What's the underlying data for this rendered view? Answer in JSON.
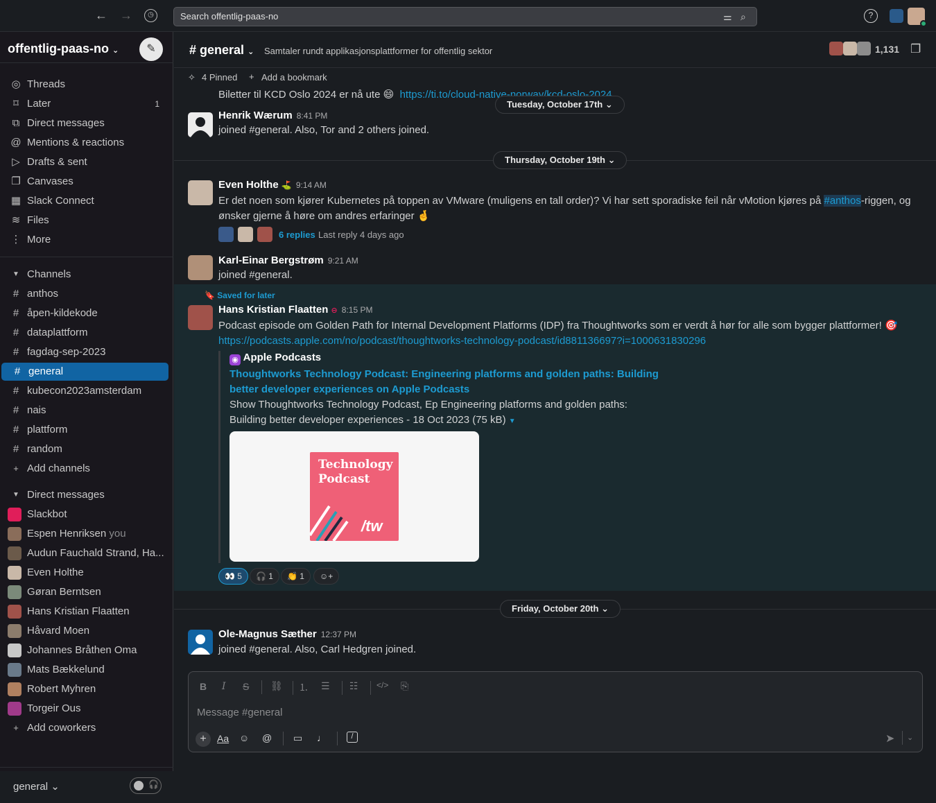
{
  "topbar": {
    "search_placeholder": "Search offentlig-paas-no",
    "help": "?"
  },
  "sidebar": {
    "workspace": "offentlig-paas-no",
    "nav": [
      {
        "label": "Threads",
        "icon": "threads-icon",
        "glyph": "◎",
        "count": ""
      },
      {
        "label": "Later",
        "icon": "bookmark-icon",
        "glyph": "⌑",
        "count": "1"
      },
      {
        "label": "Direct messages",
        "icon": "dm-icon",
        "glyph": "⧉",
        "count": ""
      },
      {
        "label": "Mentions & reactions",
        "icon": "at-icon",
        "glyph": "@",
        "count": ""
      },
      {
        "label": "Drafts & sent",
        "icon": "send-icon",
        "glyph": "▷",
        "count": ""
      },
      {
        "label": "Canvases",
        "icon": "canvas-icon",
        "glyph": "❐",
        "count": ""
      },
      {
        "label": "Slack Connect",
        "icon": "building-icon",
        "glyph": "▦",
        "count": ""
      },
      {
        "label": "Files",
        "icon": "files-icon",
        "glyph": "≋",
        "count": ""
      },
      {
        "label": "More",
        "icon": "more-icon",
        "glyph": "⋮",
        "count": ""
      }
    ],
    "channels_header": "Channels",
    "channels": [
      "anthos",
      "åpen-kildekode",
      "dataplattform",
      "fagdag-sep-2023",
      "general",
      "kubecon2023amsterdam",
      "nais",
      "plattform",
      "random"
    ],
    "add_channels": "Add channels",
    "dm_header": "Direct messages",
    "dms": [
      {
        "name": "Slackbot",
        "extra": "",
        "color": "#e01e5a"
      },
      {
        "name": "Espen Henriksen",
        "extra": "you",
        "color": "#8a6d5a"
      },
      {
        "name": "Audun Fauchald Strand, Ha...",
        "extra": "",
        "color": "#6b5a4a"
      },
      {
        "name": "Even Holthe",
        "extra": "",
        "color": "#c9b8a8"
      },
      {
        "name": "Gøran Berntsen",
        "extra": "",
        "color": "#7b8a7a"
      },
      {
        "name": "Hans Kristian Flaatten",
        "extra": "",
        "color": "#a0524a"
      },
      {
        "name": "Håvard Moen",
        "extra": "",
        "color": "#8c7c6c"
      },
      {
        "name": "Johannes Bråthen Oma",
        "extra": "",
        "color": "#c8c8c8"
      },
      {
        "name": "Mats Bækkelund",
        "extra": "",
        "color": "#6a7a8a"
      },
      {
        "name": "Robert Myhren",
        "extra": "",
        "color": "#b08060"
      },
      {
        "name": "Torgeir Ous",
        "extra": "",
        "color": "#a03a8a"
      }
    ],
    "add_coworkers": "Add coworkers",
    "footer_label": "general"
  },
  "channel": {
    "name": "# general",
    "topic": "Samtaler rundt applikasjonsplattformer for offentlig sektor",
    "member_count": "1,131",
    "pinned": "4 Pinned",
    "add_bookmark": "Add a bookmark"
  },
  "messages": {
    "prev_text": "Biletter til KCD Oslo 2024 er nå ute 😄",
    "prev_link": "https://ti.to/cloud-native-norway/kcd-oslo-2024",
    "date1": "Tuesday, October 17th",
    "m1": {
      "author": "Henrik Wærum",
      "time": "8:41 PM",
      "text": "joined #general. Also, Tor and 2 others joined."
    },
    "date2": "Thursday, October 19th",
    "m2": {
      "author": "Even Holthe",
      "time": "9:14 AM",
      "text_a": "Er det noen som kjører Kubernetes på toppen av VMware (muligens en tall order)? Vi har sett sporadiske feil når vMotion kjøres på ",
      "mention": "#anthos",
      "text_b": "-riggen, og",
      "text_c": "ønsker gjerne å høre om andres erfaringer 🤞",
      "replies": "6 replies",
      "last_reply": "Last reply 4 days ago"
    },
    "m3": {
      "author": "Karl-Einar Bergstrøm",
      "time": "9:21 AM",
      "text": "joined #general."
    },
    "saved": "Saved for later",
    "m4": {
      "author": "Hans Kristian Flaatten",
      "time": "8:15 PM",
      "text": "Podcast episode om Golden Path for Internal Development Platforms (IDP) fra Thoughtworks som er verdt å hør for alle som bygger plattformer! 🎯",
      "link": "https://podcasts.apple.com/no/podcast/thoughtworks-technology-podcast/id881136697?i=1000631830296",
      "unfurl_source": "Apple Podcasts",
      "unfurl_title_1": "Thoughtworks Technology Podcast: Engineering platforms and golden paths: Building",
      "unfurl_title_2": "better developer experiences on Apple Podcasts",
      "unfurl_desc_1": "Show Thoughtworks Technology Podcast, Ep Engineering platforms and golden paths:",
      "unfurl_desc_2": "Building better developer experiences - 18 Oct 2023 (75 kB)",
      "podcast_art_1": "Technology",
      "podcast_art_2": "Podcast",
      "podcast_art_brand": "/tw",
      "reactions": [
        {
          "emoji": "👀",
          "count": "5"
        },
        {
          "emoji": "🎧",
          "count": "1"
        },
        {
          "emoji": "👏",
          "count": "1"
        }
      ]
    },
    "date3": "Friday, October 20th",
    "m5": {
      "author": "Ole-Magnus Sæther",
      "time": "12:37 PM",
      "text": "joined #general. Also, Carl Hedgren joined."
    }
  },
  "composer": {
    "placeholder": "Message #general"
  }
}
